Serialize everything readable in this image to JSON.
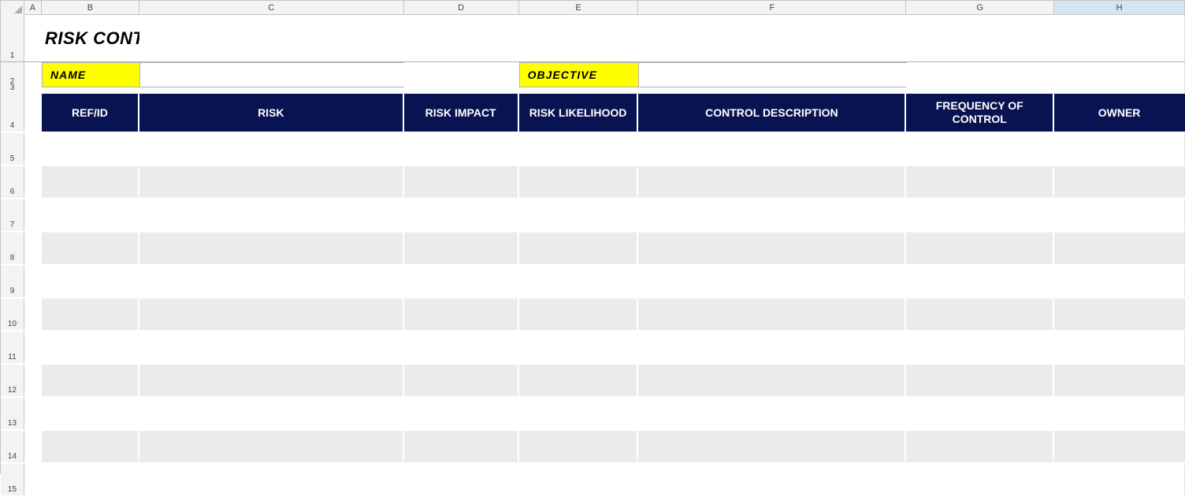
{
  "columns": [
    "A",
    "B",
    "C",
    "D",
    "E",
    "F",
    "G",
    "H"
  ],
  "rows": [
    1,
    2,
    3,
    4,
    5,
    6,
    7,
    8,
    9,
    10,
    11,
    12,
    13,
    14,
    15
  ],
  "selected_column": "H",
  "title": "RISK CONTROL MATRIX",
  "labels": {
    "name": "NAME",
    "objective": "OBJECTIVE"
  },
  "inputs": {
    "name_value": "",
    "objective_value": ""
  },
  "table_headers": {
    "ref_id": "REF/ID",
    "risk": "RISK",
    "risk_impact": "RISK IMPACT",
    "risk_likelihood": "RISK LIKELIHOOD",
    "control_description": "CONTROL DESCRIPTION",
    "frequency_of_control": "FREQUENCY OF CONTROL",
    "owner": "OWNER"
  },
  "data_rows": [
    {
      "ref_id": "",
      "risk": "",
      "risk_impact": "",
      "risk_likelihood": "",
      "control_description": "",
      "frequency_of_control": "",
      "owner": ""
    },
    {
      "ref_id": "",
      "risk": "",
      "risk_impact": "",
      "risk_likelihood": "",
      "control_description": "",
      "frequency_of_control": "",
      "owner": ""
    },
    {
      "ref_id": "",
      "risk": "",
      "risk_impact": "",
      "risk_likelihood": "",
      "control_description": "",
      "frequency_of_control": "",
      "owner": ""
    },
    {
      "ref_id": "",
      "risk": "",
      "risk_impact": "",
      "risk_likelihood": "",
      "control_description": "",
      "frequency_of_control": "",
      "owner": ""
    },
    {
      "ref_id": "",
      "risk": "",
      "risk_impact": "",
      "risk_likelihood": "",
      "control_description": "",
      "frequency_of_control": "",
      "owner": ""
    },
    {
      "ref_id": "",
      "risk": "",
      "risk_impact": "",
      "risk_likelihood": "",
      "control_description": "",
      "frequency_of_control": "",
      "owner": ""
    },
    {
      "ref_id": "",
      "risk": "",
      "risk_impact": "",
      "risk_likelihood": "",
      "control_description": "",
      "frequency_of_control": "",
      "owner": ""
    },
    {
      "ref_id": "",
      "risk": "",
      "risk_impact": "",
      "risk_likelihood": "",
      "control_description": "",
      "frequency_of_control": "",
      "owner": ""
    },
    {
      "ref_id": "",
      "risk": "",
      "risk_impact": "",
      "risk_likelihood": "",
      "control_description": "",
      "frequency_of_control": "",
      "owner": ""
    },
    {
      "ref_id": "",
      "risk": "",
      "risk_impact": "",
      "risk_likelihood": "",
      "control_description": "",
      "frequency_of_control": "",
      "owner": ""
    },
    {
      "ref_id": "",
      "risk": "",
      "risk_impact": "",
      "risk_likelihood": "",
      "control_description": "",
      "frequency_of_control": "",
      "owner": ""
    }
  ]
}
